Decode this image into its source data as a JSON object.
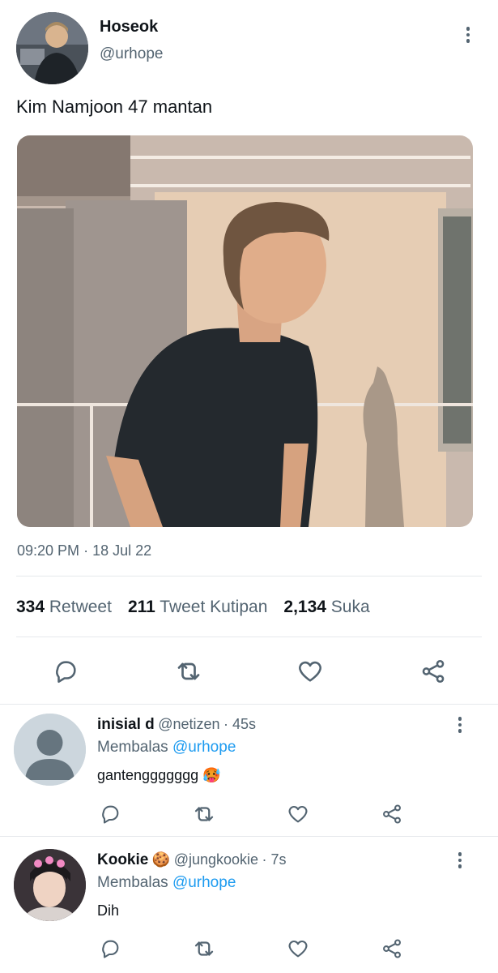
{
  "tweet": {
    "author_name": "Hoseok",
    "author_handle": "@urhope",
    "text": "Kim Namjoon 47 mantan",
    "time": "09:20 PM",
    "separator": "·",
    "date": "18 Jul 22"
  },
  "stats": {
    "retweets_count": "334",
    "retweets_label": "Retweet",
    "quotes_count": "211",
    "quotes_label": "Tweet Kutipan",
    "likes_count": "2,134",
    "likes_label": "Suka"
  },
  "actions": [
    "comment-icon",
    "retweet-icon",
    "heart-icon",
    "share-icon"
  ],
  "replies": [
    {
      "name": "inisial d",
      "emoji": "",
      "handle": "@netizen",
      "time": "· 45s",
      "replying_prefix": "Membalas",
      "replying_to": "@urhope",
      "text": "gantenggggggg",
      "text_emoji": "🥵"
    },
    {
      "name": "Kookie",
      "emoji": "🍪",
      "handle": "@jungkookie",
      "time": "· 7s",
      "replying_prefix": "Membalas",
      "replying_to": "@urhope",
      "text": "Dih",
      "text_emoji": ""
    }
  ],
  "colors": {
    "link": "#1d9bf0",
    "secondary_text": "#536471",
    "icon": "#536471"
  }
}
